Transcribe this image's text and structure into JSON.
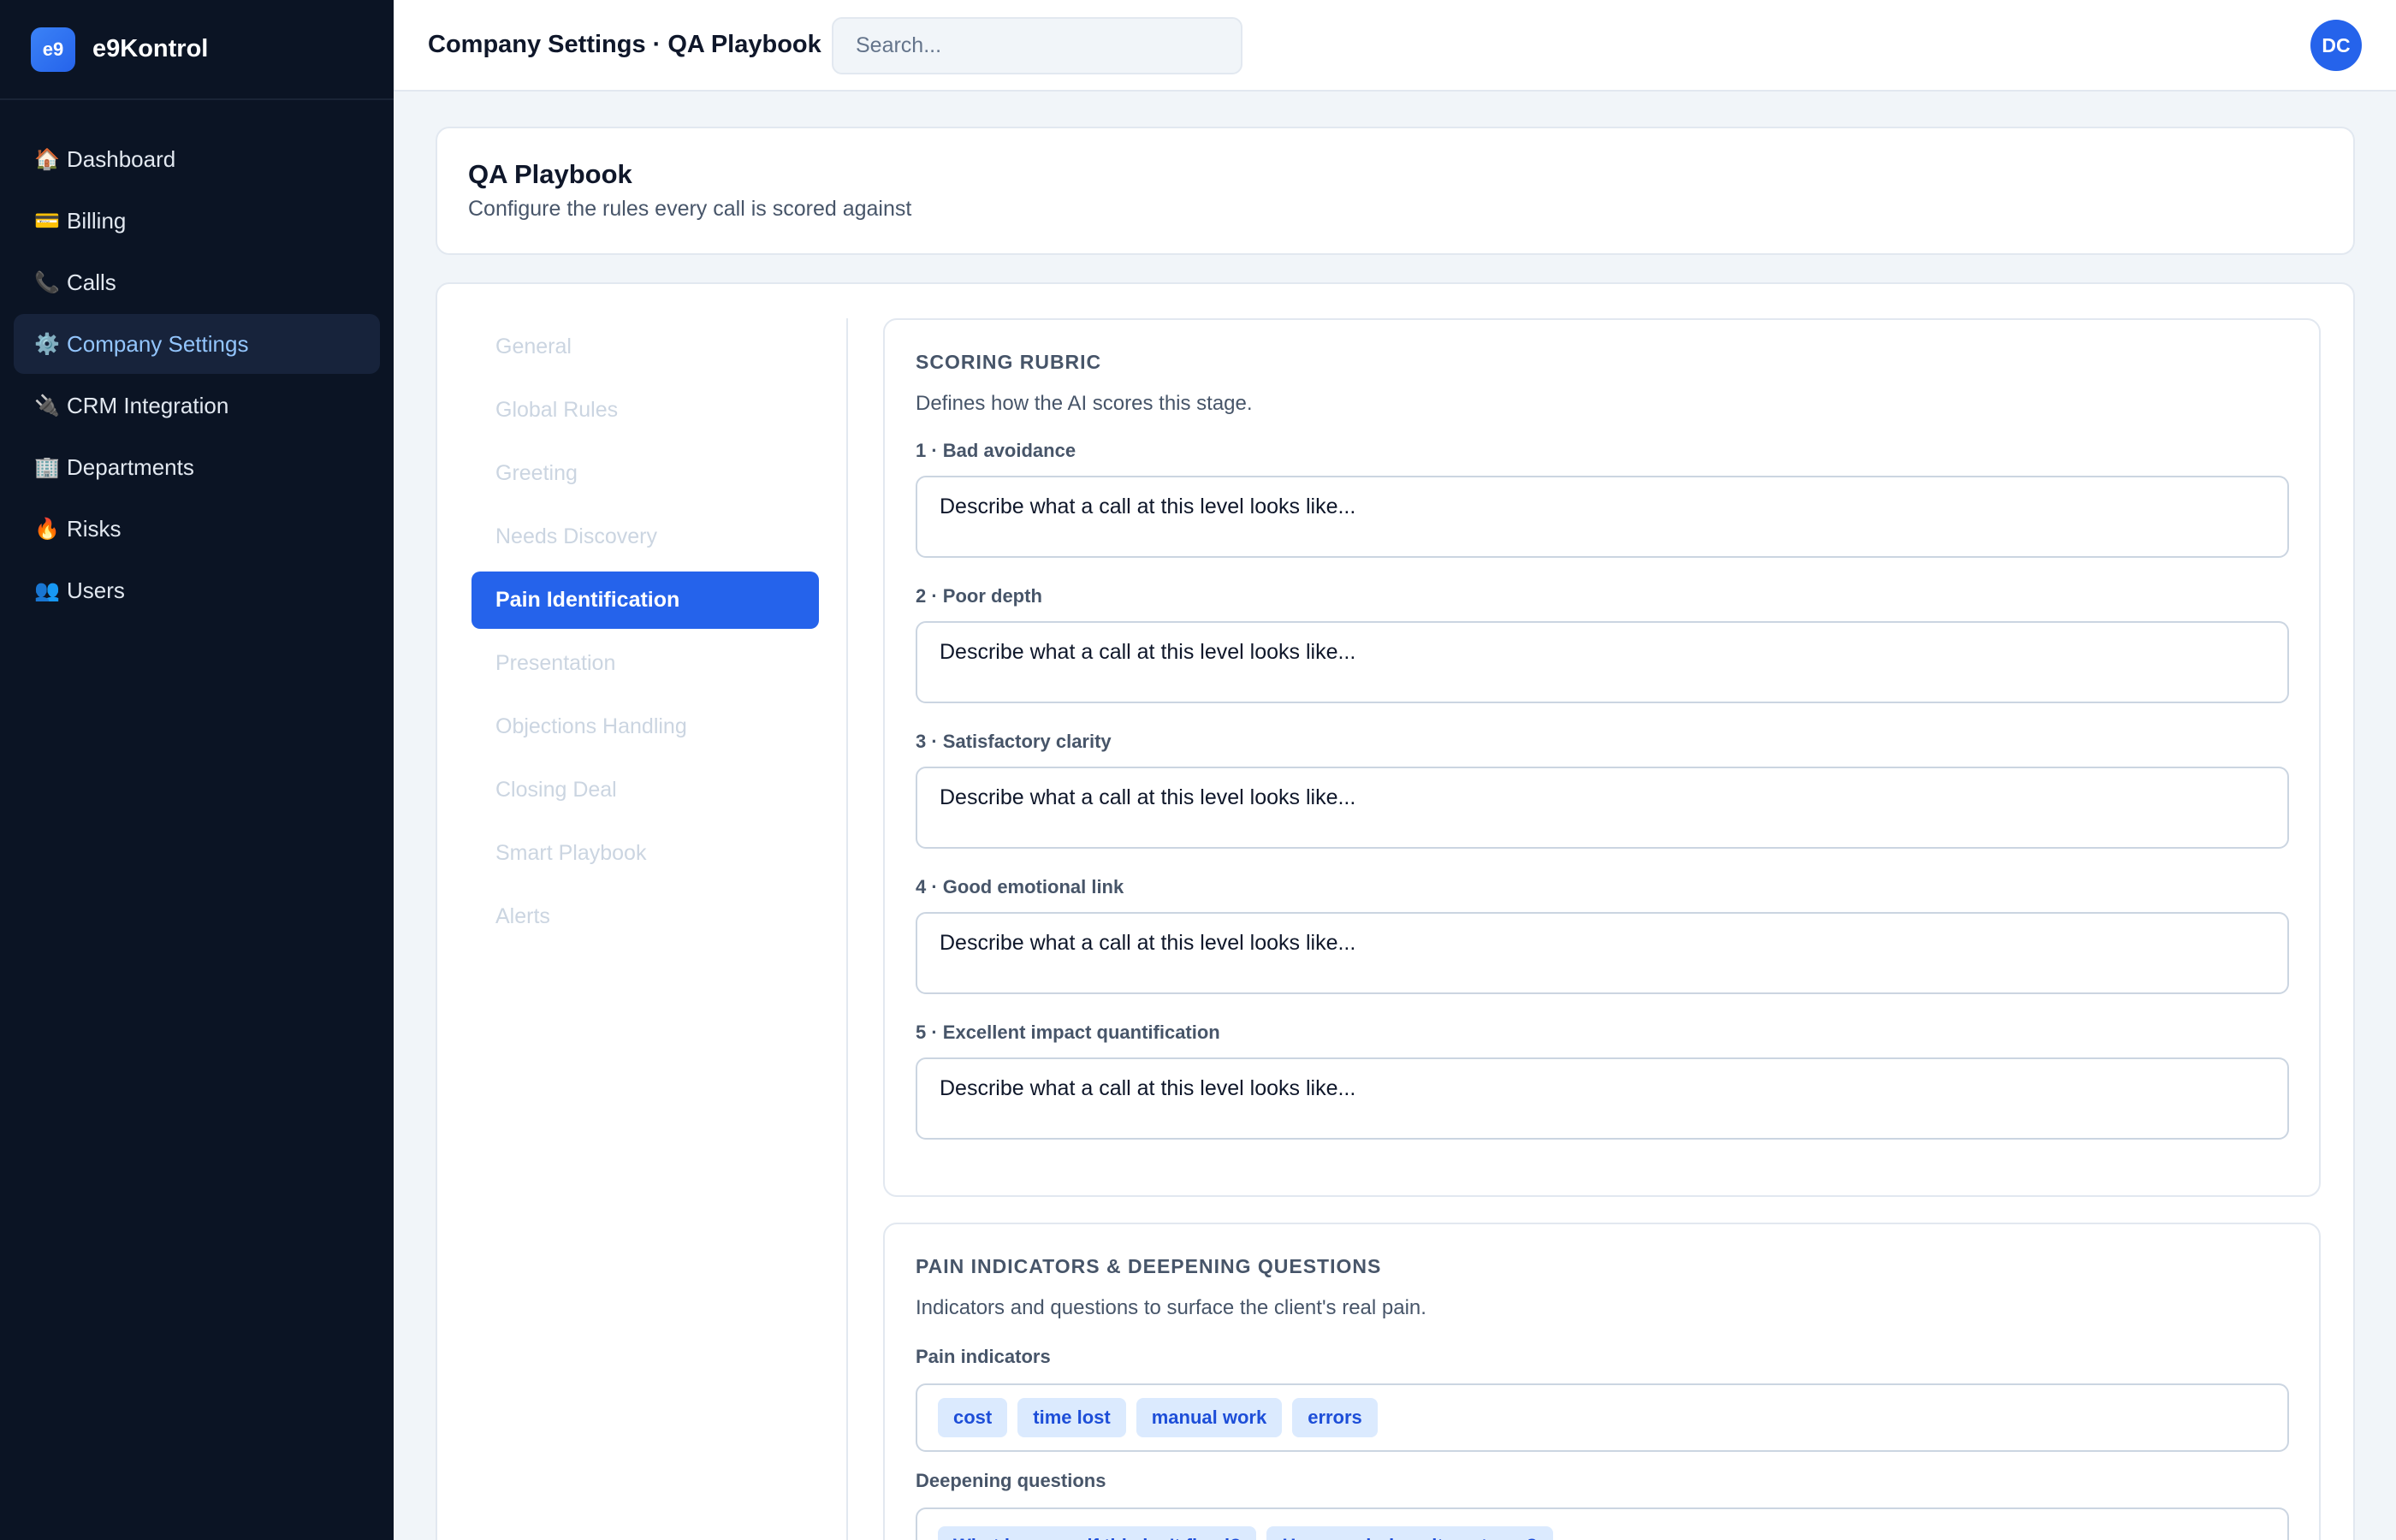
{
  "brand": {
    "logo": "e9",
    "name": "e9Kontrol"
  },
  "sidebar": {
    "items": [
      {
        "icon": "🏠",
        "icon_name": "home-icon",
        "label": "Dashboard",
        "active": false
      },
      {
        "icon": "💳",
        "icon_name": "credit-card-icon",
        "label": "Billing",
        "active": false
      },
      {
        "icon": "📞",
        "icon_name": "phone-icon",
        "label": "Calls",
        "active": false
      },
      {
        "icon": "⚙️",
        "icon_name": "gear-icon",
        "label": "Company Settings",
        "active": true
      },
      {
        "icon": "🔌",
        "icon_name": "plug-icon",
        "label": "CRM Integration",
        "active": false
      },
      {
        "icon": "🏢",
        "icon_name": "building-icon",
        "label": "Departments",
        "active": false
      },
      {
        "icon": "🔥",
        "icon_name": "fire-icon",
        "label": "Risks",
        "active": false
      },
      {
        "icon": "👥",
        "icon_name": "users-icon",
        "label": "Users",
        "active": false
      }
    ]
  },
  "topbar": {
    "title": "Company Settings · QA Playbook",
    "search_placeholder": "Search...",
    "avatar_initials": "DC"
  },
  "header": {
    "title": "QA Playbook",
    "subtitle": "Configure the rules every call is scored against"
  },
  "stages": {
    "items": [
      {
        "label": "General",
        "active": false
      },
      {
        "label": "Global Rules",
        "active": false
      },
      {
        "label": "Greeting",
        "active": false
      },
      {
        "label": "Needs Discovery",
        "active": false
      },
      {
        "label": "Pain Identification",
        "active": true
      },
      {
        "label": "Presentation",
        "active": false
      },
      {
        "label": "Objections Handling",
        "active": false
      },
      {
        "label": "Closing Deal",
        "active": false
      },
      {
        "label": "Smart Playbook",
        "active": false
      },
      {
        "label": "Alerts",
        "active": false
      }
    ]
  },
  "rubric": {
    "title": "SCORING RUBRIC",
    "description": "Defines how the AI scores this stage.",
    "levels": [
      {
        "label": "1 · Bad avoidance",
        "placeholder": "Describe what a call at this level looks like..."
      },
      {
        "label": "2 · Poor depth",
        "placeholder": "Describe what a call at this level looks like..."
      },
      {
        "label": "3 · Satisfactory clarity",
        "placeholder": "Describe what a call at this level looks like..."
      },
      {
        "label": "4 · Good emotional link",
        "placeholder": "Describe what a call at this level looks like..."
      },
      {
        "label": "5 · Excellent impact quantification",
        "placeholder": "Describe what a call at this level looks like..."
      }
    ]
  },
  "pain": {
    "title": "PAIN INDICATORS & DEEPENING QUESTIONS",
    "description": "Indicators and questions to surface the client's real pain.",
    "indicators_label": "Pain indicators",
    "indicators": [
      "cost",
      "time lost",
      "manual work",
      "errors"
    ],
    "questions_label": "Deepening questions",
    "questions": [
      "What happens if this isn't fixed?",
      "How much does it cost you?"
    ]
  },
  "colors": {
    "sidebar_bg": "#0b1424",
    "accent": "#2563eb",
    "active_nav_text": "#93c5fd",
    "tag_bg": "#dbeafe"
  }
}
